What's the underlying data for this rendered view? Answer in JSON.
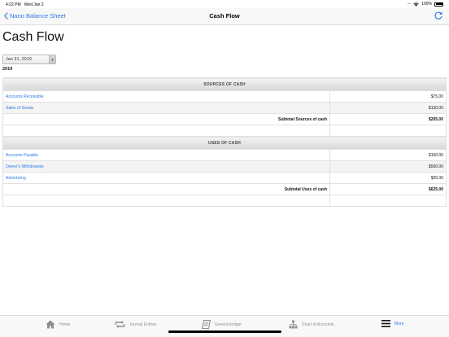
{
  "status_bar": {
    "time": "4:22 PM",
    "date": "Wed Jan 2",
    "battery": "100%"
  },
  "nav": {
    "back_label": "Nano Balance Sheet",
    "title": "Cash Flow"
  },
  "page": {
    "title": "Cash Flow",
    "selected_date": "Jan 31, 2019",
    "year": "2019"
  },
  "sources": {
    "header": "SOURCES OF CASH",
    "rows": [
      {
        "label": "Accounts Receivable",
        "amount": "$75.00"
      },
      {
        "label": "Sales of Goods",
        "amount": "$130.00"
      }
    ],
    "subtotal_label": "Subtotal Sources of cash",
    "subtotal_amount": "$205.00"
  },
  "uses": {
    "header": "USES OF CASH",
    "rows": [
      {
        "label": "Accounts Payable",
        "amount": "$100.00"
      },
      {
        "label": "Owner's Withdrawals",
        "amount": "$500.00"
      },
      {
        "label": "Advertising",
        "amount": "$25.00"
      }
    ],
    "subtotal_label": "Subtotal Uses of cash",
    "subtotal_amount": "$625.00"
  },
  "tabs": [
    {
      "label": "Home",
      "icon": "house-icon"
    },
    {
      "label": "Journal Entries",
      "icon": "repeat-arrows-icon"
    },
    {
      "label": "General ledger",
      "icon": "book-icon"
    },
    {
      "label": "Chart of Accounts",
      "icon": "org-chart-icon"
    },
    {
      "label": "More",
      "icon": "menu-lines-icon"
    }
  ],
  "colors": {
    "accent": "#2a7ae4",
    "tab_inactive": "#8e8e93"
  }
}
